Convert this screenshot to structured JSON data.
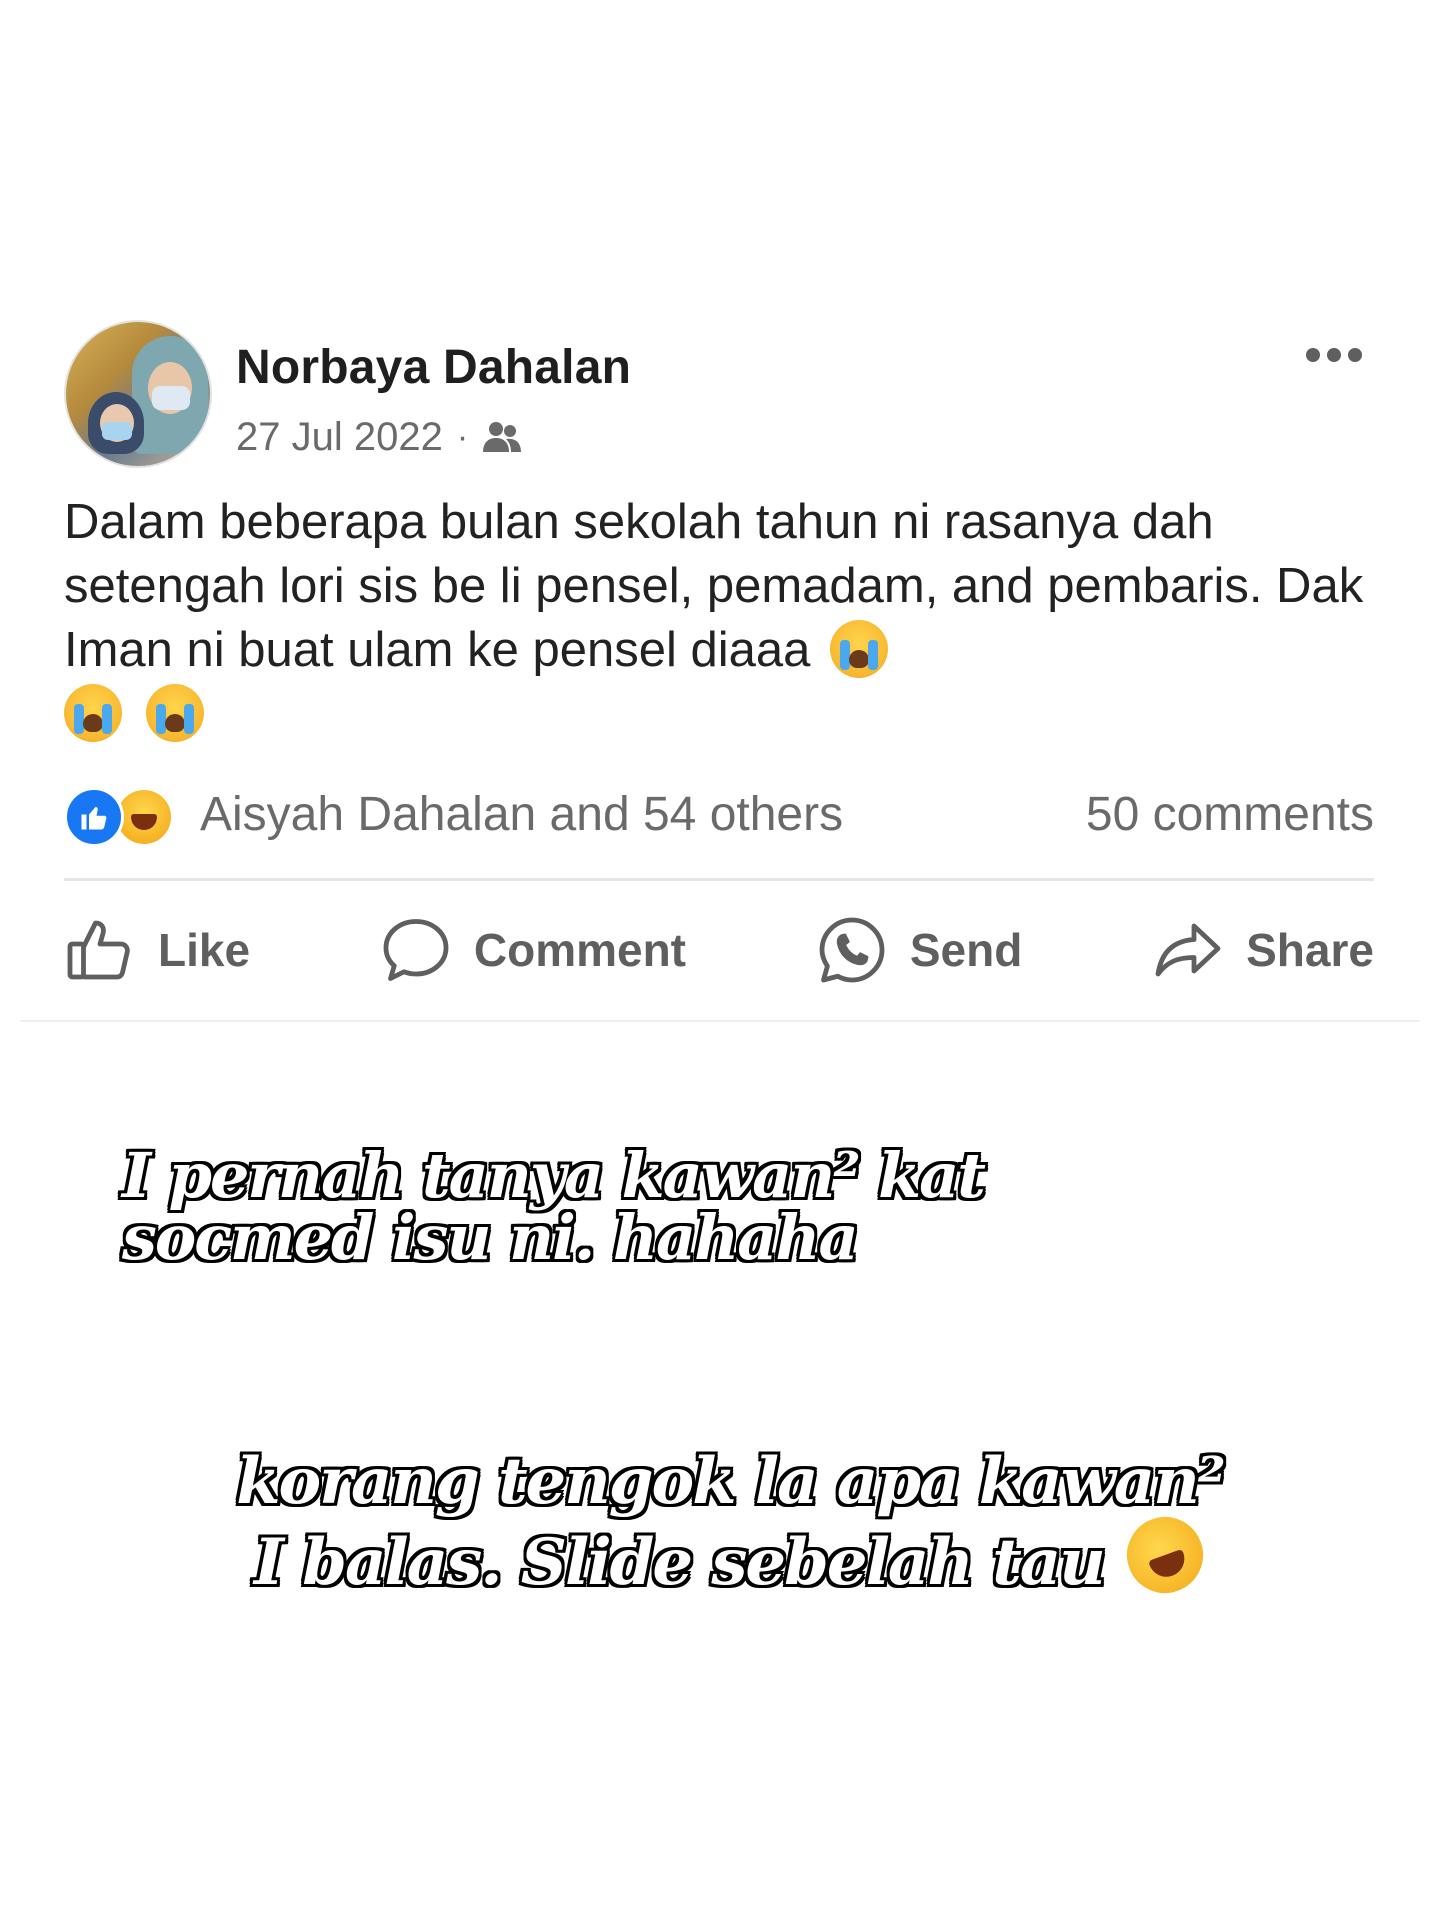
{
  "post": {
    "author": "Norbaya Dahalan",
    "date": "27 Jul 2022",
    "separator": "·",
    "audience_icon": "friends-icon",
    "more_icon": "more-dots-icon",
    "body": "Dalam beberapa bulan sekolah tahun ni rasanya dah setengah lori sis be li pensel, pemadam, and pembaris. Dak Iman ni buat ulam ke pensel diaaa",
    "body_emojis": [
      "crying-face",
      "crying-face",
      "crying-face"
    ],
    "reactions": {
      "icons": [
        "like",
        "haha"
      ],
      "summary": "Aisyah Dahalan and 54 others",
      "comments": "50 comments"
    },
    "actions": {
      "like": "Like",
      "comment": "Comment",
      "send": "Send",
      "share": "Share"
    },
    "colors": {
      "like_blue": "#1877f2",
      "text": "#222222",
      "muted": "#6a6a6a"
    }
  },
  "captions": {
    "first_line1": "I pernah tanya kawan² kat",
    "first_line2": "socmed isu ni. hahaha",
    "second_line1": "korang tengok la apa kawan²",
    "second_line2": "I balas. Slide sebelah tau",
    "second_emoji": "rolling-on-floor-laughing"
  }
}
